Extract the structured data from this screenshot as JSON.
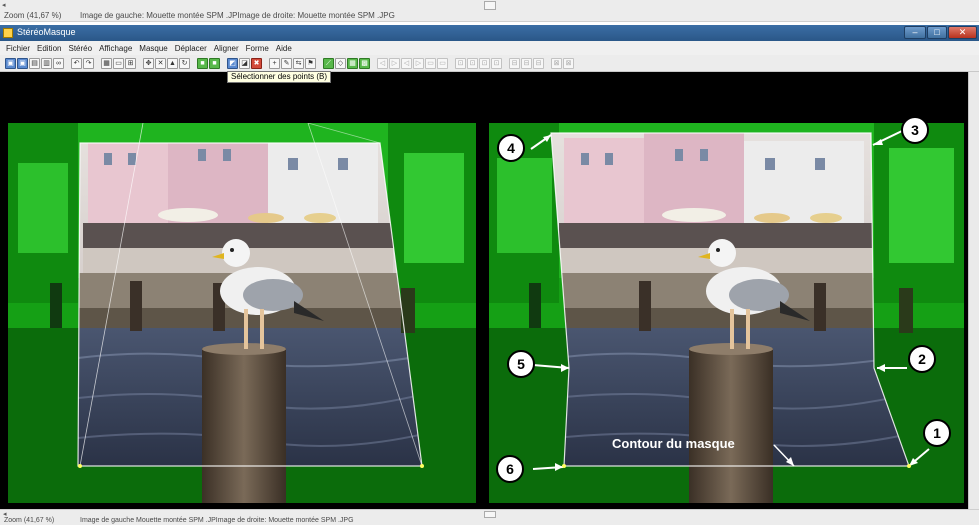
{
  "top_status": {
    "zoom": "Zoom (41,67 %)",
    "images": "Image de gauche: Mouette montée SPM .JPImage de droite: Mouette montée SPM .JPG"
  },
  "window": {
    "title": "StéréoMasque",
    "min_glyph": "–",
    "max_glyph": "□",
    "close_glyph": "✕"
  },
  "menu": [
    "Fichier",
    "Edition",
    "Stéréo",
    "Affichage",
    "Masque",
    "Déplacer",
    "Aligner",
    "Forme",
    "Aide"
  ],
  "toolbar": {
    "tooltip": "Sélectionner des points (B)"
  },
  "annotations": {
    "callouts": [
      "1",
      "2",
      "3",
      "4",
      "5",
      "6"
    ],
    "contour_label": "Contour du masque"
  },
  "bottom_status": {
    "zoom": "Zoom (41,67 %)",
    "images": "Image de gauche Mouette montée SPM .JPImage de droite: Mouette montée SPM .JPG"
  },
  "colors": {
    "mask_green": "#00c800",
    "titlebar": "#2f5f93",
    "callout_bg": "#ffffff"
  }
}
